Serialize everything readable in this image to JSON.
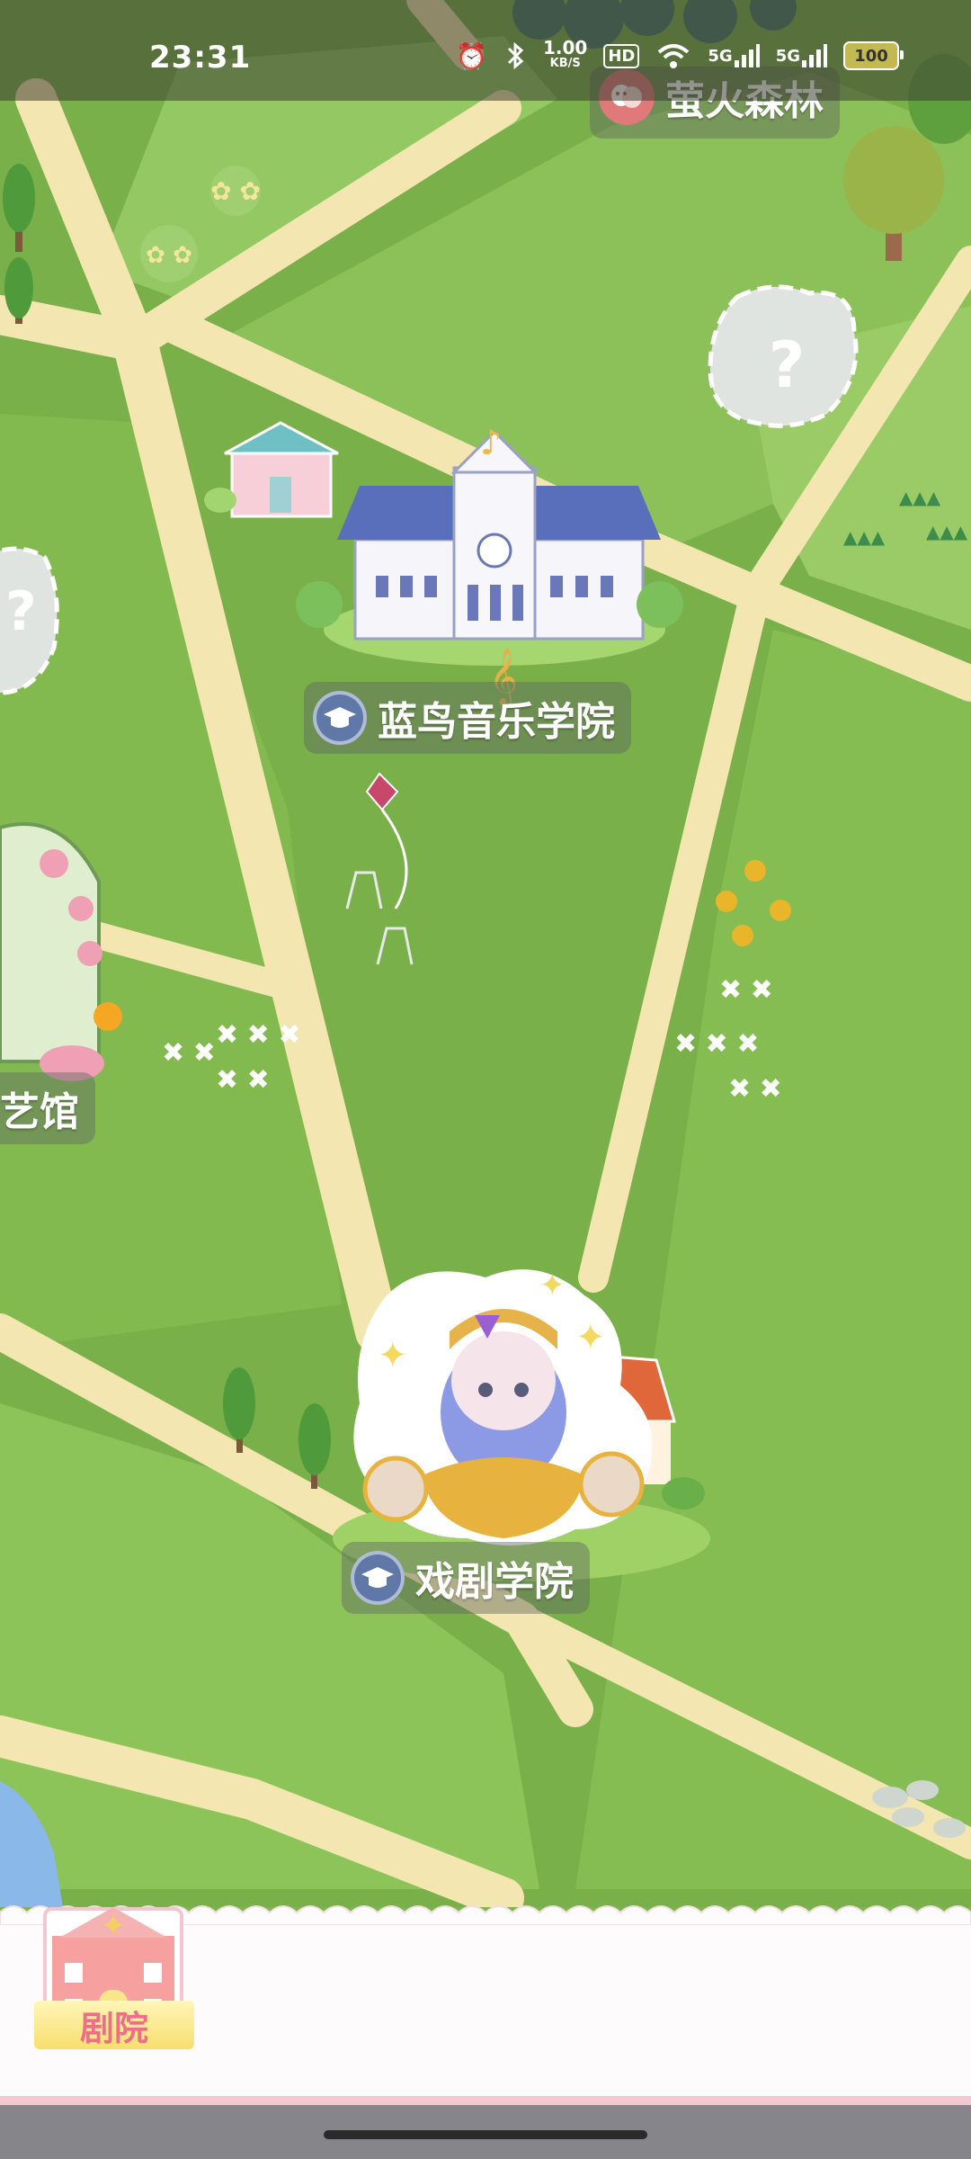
{
  "status_bar": {
    "time": "23:31",
    "net_speed_value": "1.00",
    "net_speed_unit": "KB/S",
    "hd_label": "HD",
    "signal1_label": "5G",
    "signal2_label": "5G",
    "battery_level": "100",
    "icons": [
      "alarm-icon",
      "bluetooth-icon",
      "wifi-icon",
      "signal-icon",
      "battery-icon"
    ]
  },
  "map": {
    "locations": [
      {
        "label": "萤火森林",
        "badge_icon": "theater-mask-icon"
      },
      {
        "label": "蓝鸟音乐学院",
        "badge_icon": "graduation-cap-icon"
      },
      {
        "label": "艺馆",
        "badge_icon": null
      },
      {
        "label": "戏剧学院",
        "badge_icon": "graduation-cap-icon"
      }
    ],
    "unknown_marker_text": "?",
    "colors": {
      "grass": "#7fb54d",
      "grass_light": "#9ccc63",
      "path": "#f4e6b0",
      "water": "#8ab8e8",
      "label_bg": "#5f695f"
    }
  },
  "bottom_bar": {
    "theater_button_label": "剧院",
    "label_color": "#ec6f8a"
  }
}
